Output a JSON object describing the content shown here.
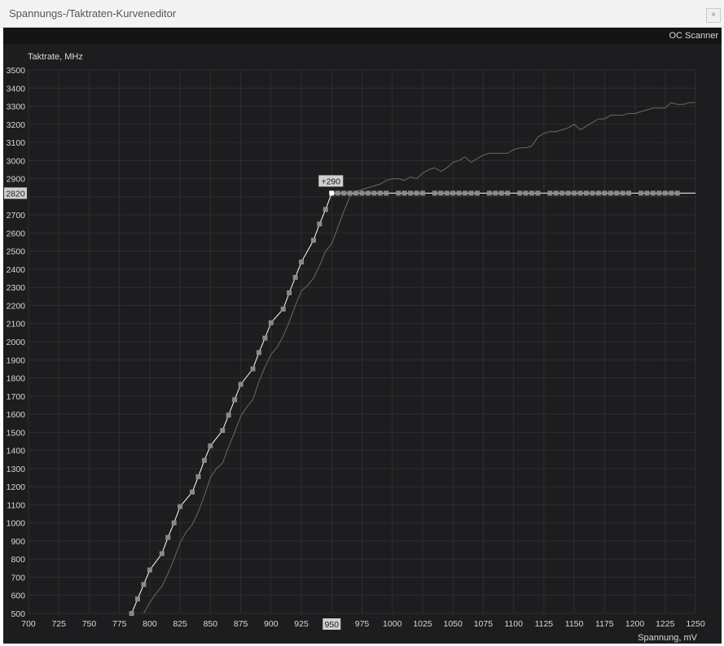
{
  "window": {
    "title": "Spannungs-/Taktraten-Kurveneditor",
    "close_label": "×"
  },
  "toolbar": {
    "oc_scanner_label": "OC Scanner"
  },
  "colors": {
    "background": "#1d1d1f",
    "grid": "#2e2e30",
    "curve": "#ffffff",
    "reference": "#6a6a6a",
    "points": "#8a8a8a"
  },
  "chart_data": {
    "type": "line",
    "ylabel": "Taktrate, MHz",
    "xlabel": "Spannung, mV",
    "xlim": [
      700,
      1250
    ],
    "ylim": [
      500,
      3500
    ],
    "xticks": [
      700,
      725,
      750,
      775,
      800,
      825,
      850,
      875,
      900,
      925,
      950,
      975,
      1000,
      1025,
      1050,
      1075,
      1100,
      1125,
      1150,
      1175,
      1200,
      1225,
      1250
    ],
    "yticks": [
      500,
      600,
      700,
      800,
      900,
      1000,
      1100,
      1200,
      1300,
      1400,
      1500,
      1600,
      1700,
      1800,
      1900,
      2000,
      2100,
      2200,
      2300,
      2400,
      2500,
      2600,
      2700,
      2800,
      2900,
      3000,
      3100,
      3200,
      3300,
      3400,
      3500
    ],
    "highlight": {
      "x": 950,
      "y": 2820,
      "x_label": "950",
      "y_label": "2820",
      "offset_label": "+290"
    },
    "series": [
      {
        "role": "edited-curve",
        "x": [
          785,
          790,
          795,
          800,
          810,
          815,
          820,
          825,
          835,
          840,
          845,
          850,
          860,
          865,
          870,
          875,
          885,
          890,
          895,
          900,
          910,
          915,
          920,
          925,
          935,
          940,
          945,
          950
        ],
        "y": [
          500,
          580,
          660,
          740,
          830,
          920,
          1000,
          1090,
          1170,
          1255,
          1345,
          1425,
          1510,
          1595,
          1680,
          1765,
          1850,
          1940,
          2020,
          2105,
          2180,
          2270,
          2355,
          2440,
          2560,
          2650,
          2730,
          2820
        ],
        "flat_x": [
          955,
          960,
          965,
          970,
          975,
          980,
          985,
          990,
          995,
          1005,
          1010,
          1015,
          1020,
          1025,
          1035,
          1040,
          1045,
          1050,
          1055,
          1060,
          1065,
          1070,
          1080,
          1085,
          1090,
          1095,
          1105,
          1110,
          1115,
          1120,
          1130,
          1135,
          1140,
          1145,
          1150,
          1155,
          1160,
          1165,
          1170,
          1175,
          1180,
          1185,
          1190,
          1195,
          1205,
          1210,
          1215,
          1220,
          1225,
          1230,
          1235
        ],
        "flat_y": 2820
      },
      {
        "role": "default-curve",
        "x": [
          795,
          800,
          805,
          810,
          815,
          820,
          825,
          830,
          835,
          840,
          845,
          850,
          855,
          860,
          865,
          870,
          875,
          880,
          885,
          890,
          895,
          900,
          905,
          910,
          915,
          920,
          925,
          930,
          935,
          940,
          945,
          950,
          955,
          960,
          965,
          970,
          975,
          980,
          985,
          990,
          995,
          1000,
          1005,
          1010,
          1015,
          1020,
          1025,
          1030,
          1035,
          1040,
          1045,
          1050,
          1055,
          1060,
          1065,
          1070,
          1075,
          1080,
          1085,
          1090,
          1095,
          1100,
          1105,
          1110,
          1115,
          1120,
          1125,
          1130,
          1135,
          1140,
          1145,
          1150,
          1155,
          1160,
          1165,
          1170,
          1175,
          1180,
          1185,
          1190,
          1195,
          1200,
          1205,
          1210,
          1215,
          1220,
          1225,
          1230,
          1235,
          1240,
          1245,
          1250
        ],
        "y": [
          500,
          560,
          610,
          650,
          720,
          800,
          890,
          950,
          990,
          1060,
          1150,
          1250,
          1300,
          1330,
          1420,
          1500,
          1590,
          1640,
          1680,
          1780,
          1860,
          1930,
          1970,
          2030,
          2110,
          2200,
          2280,
          2310,
          2350,
          2420,
          2500,
          2540,
          2630,
          2720,
          2800,
          2830,
          2840,
          2850,
          2860,
          2870,
          2890,
          2900,
          2900,
          2890,
          2910,
          2900,
          2930,
          2950,
          2960,
          2940,
          2960,
          2990,
          3000,
          3020,
          2990,
          3010,
          3030,
          3040,
          3040,
          3040,
          3040,
          3060,
          3070,
          3070,
          3080,
          3130,
          3150,
          3160,
          3160,
          3170,
          3180,
          3200,
          3170,
          3190,
          3210,
          3230,
          3230,
          3250,
          3250,
          3250,
          3260,
          3260,
          3270,
          3280,
          3290,
          3290,
          3290,
          3320,
          3310,
          3310,
          3320,
          3320
        ]
      }
    ]
  }
}
